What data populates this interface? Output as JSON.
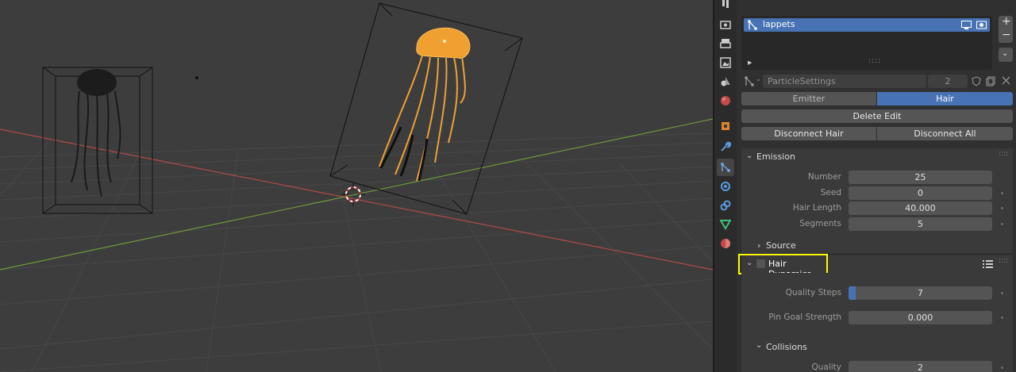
{
  "list": {
    "items": [
      {
        "label": "lappets"
      }
    ]
  },
  "settings": {
    "name": "ParticleSettings",
    "users": "2"
  },
  "type_tabs": {
    "emitter": "Emitter",
    "hair": "Hair"
  },
  "buttons": {
    "delete_edit": "Delete Edit",
    "disconnect_hair": "Disconnect Hair",
    "disconnect_all": "Disconnect All"
  },
  "emission": {
    "title": "Emission",
    "number_label": "Number",
    "number": "25",
    "seed_label": "Seed",
    "seed": "0",
    "hair_length_label": "Hair Length",
    "hair_length": "40.000",
    "segments_label": "Segments",
    "segments": "5",
    "source_title": "Source"
  },
  "hair_dynamics": {
    "title": "Hair Dynamics",
    "quality_steps_label": "Quality Steps",
    "quality_steps": "7",
    "quality_steps_fill": 0.05,
    "pin_goal_label": "Pin Goal Strength",
    "pin_goal": "0.000",
    "collisions_title": "Collisions",
    "quality_label": "Quality",
    "quality": "2"
  },
  "colors": {
    "viewport_bg": "#3d3d3d",
    "selection_orange": "#f0a030",
    "list_highlight": "#4772b3",
    "x_axis": "#b04a4a",
    "y_axis": "#6f9a3a",
    "callout": "#ffff00"
  }
}
